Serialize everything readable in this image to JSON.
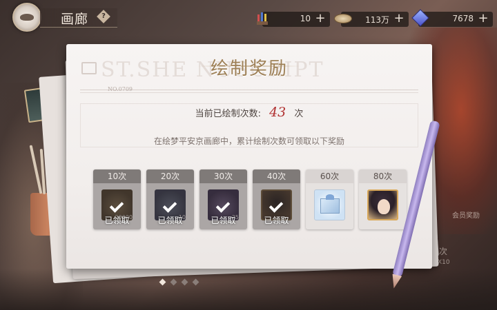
{
  "topbar": {
    "title": "画廊",
    "help_symbol": "?",
    "resources": [
      {
        "icon": "paintbrush-icon",
        "value": "10",
        "plus": "+"
      },
      {
        "icon": "coin-icon",
        "value": "113万",
        "plus": "+"
      },
      {
        "icon": "gem-icon",
        "value": "7678",
        "plus": "+"
      }
    ]
  },
  "panel": {
    "title": "绘制奖励",
    "watermark": "ST.SHE          NUSCRIPT",
    "doc_no": "NO.0709",
    "count_label": "当前已绘制次数:",
    "count_value": "43",
    "count_unit": "次",
    "description": "在绘梦平安京画廊中，累计绘制次数可领取以下奖励",
    "rewards": [
      {
        "threshold": "10次",
        "status": "已领取",
        "claimed": true,
        "qty": "20000",
        "icon": "coin-icon"
      },
      {
        "threshold": "20次",
        "status": "已领取",
        "claimed": true,
        "qty": "10",
        "icon": "orb-icon"
      },
      {
        "threshold": "30次",
        "status": "已领取",
        "claimed": true,
        "qty": "25",
        "icon": "flower-icon"
      },
      {
        "threshold": "40次",
        "status": "已领取",
        "claimed": true,
        "qty": "",
        "icon": "portrait-frame-icon"
      },
      {
        "threshold": "60次",
        "status": "",
        "claimed": false,
        "qty": "",
        "icon": "gift-box-icon"
      },
      {
        "threshold": "80次",
        "status": "",
        "claimed": false,
        "qty": "",
        "icon": "character-portrait-icon"
      }
    ]
  },
  "pager": {
    "total": 4,
    "active": 0
  },
  "side": {
    "label1": "会员奖励",
    "label2": "次",
    "label3": "X10"
  },
  "colors": {
    "accent_title": "#9d7f55",
    "count_highlight": "#b03030",
    "claimed_header": "#7f7a78",
    "open_header": "#d9d4d2"
  }
}
